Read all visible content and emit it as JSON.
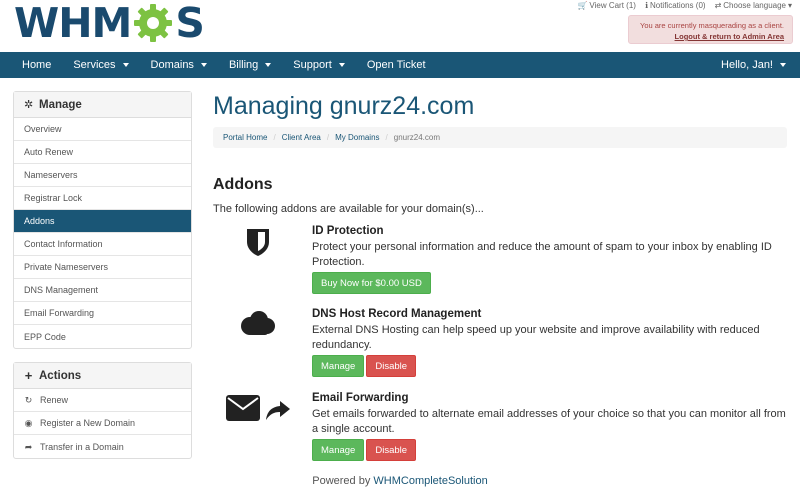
{
  "logo": {
    "prefix": "WHM",
    "suffix": "S"
  },
  "toplinks": {
    "cart": "View Cart (1)",
    "notifications": "Notifications (0)",
    "language": "Choose language"
  },
  "masquerade": {
    "message": "You are currently masquerading as a client.",
    "link": "Logout & return to Admin Area"
  },
  "navbar": {
    "items": [
      {
        "label": "Home"
      },
      {
        "label": "Services"
      },
      {
        "label": "Domains"
      },
      {
        "label": "Billing"
      },
      {
        "label": "Support"
      },
      {
        "label": "Open Ticket"
      }
    ],
    "greeting": "Hello, Jan!"
  },
  "sidebar": {
    "manage_title": "Manage",
    "manage_items": [
      {
        "label": "Overview"
      },
      {
        "label": "Auto Renew"
      },
      {
        "label": "Nameservers"
      },
      {
        "label": "Registrar Lock"
      },
      {
        "label": "Addons"
      },
      {
        "label": "Contact Information"
      },
      {
        "label": "Private Nameservers"
      },
      {
        "label": "DNS Management"
      },
      {
        "label": "Email Forwarding"
      },
      {
        "label": "EPP Code"
      }
    ],
    "actions_title": "Actions",
    "action_items": [
      {
        "label": "Renew"
      },
      {
        "label": "Register a New Domain"
      },
      {
        "label": "Transfer in a Domain"
      }
    ]
  },
  "main": {
    "title": "Managing gnurz24.com",
    "breadcrumb": [
      "Portal Home",
      "Client Area",
      "My Domains",
      "gnurz24.com"
    ],
    "addons_title": "Addons",
    "addons_intro": "The following addons are available for your domain(s)...",
    "addons": [
      {
        "name": "ID Protection",
        "description": "Protect your personal information and reduce the amount of spam to your inbox by enabling ID Protection.",
        "buy_label": "Buy Now for $0.00 USD"
      },
      {
        "name": "DNS Host Record Management",
        "description": "External DNS Hosting can help speed up your website and improve availability with reduced redundancy.",
        "manage_label": "Manage",
        "disable_label": "Disable"
      },
      {
        "name": "Email Forwarding",
        "description": "Get emails forwarded to alternate email addresses of your choice so that you can monitor all from a single account.",
        "manage_label": "Manage",
        "disable_label": "Disable"
      }
    ]
  },
  "footer": {
    "prefix": "Powered by",
    "brand": "WHMCompleteSolution"
  },
  "colors": {
    "primary": "#1a5676",
    "success": "#5cb85c",
    "danger": "#d9534f",
    "gear": "#7dc242"
  }
}
